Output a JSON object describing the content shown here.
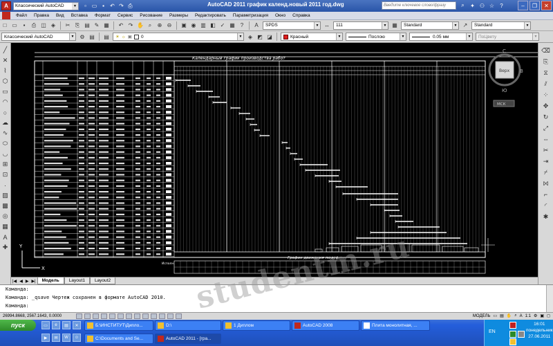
{
  "titlebar": {
    "workspace": "Классический AutoCAD",
    "title": "AutoCAD 2011     график календ.новый 2011 год.dwg",
    "search_placeholder": "Введите ключевое слово/фразу"
  },
  "menu": {
    "items": [
      "Файл",
      "Правка",
      "Вид",
      "Вставка",
      "Формат",
      "Сервис",
      "Рисование",
      "Размеры",
      "Редактировать",
      "Параметризация",
      "Окно",
      "Справка"
    ]
  },
  "toolbar1": {
    "text_style": "SPDS",
    "text_height": "111",
    "dim_style": "Standard",
    "table_style": "Standard"
  },
  "toolbar2": {
    "workspace": "Классический AutoCAD",
    "layer": "0",
    "color": "Красный",
    "color_hex": "#e02020",
    "linetype": "Послою",
    "lineweight": "0.05 мм",
    "plotstyle": "ПоЦвету"
  },
  "drawing": {
    "title": "Календарный график производства работ",
    "graph_label": "График движения людей",
    "viewcube": {
      "top": "Верх",
      "north": "С",
      "east": "В",
      "south": "Ю",
      "wcs": "МСК"
    },
    "ucs": {
      "y": "Y",
      "x": "X"
    },
    "bottom_label": "Исполн."
  },
  "layout_tabs": [
    "Модель",
    "Layout1",
    "Layout2"
  ],
  "command": {
    "lines": [
      "Команда:",
      "Команда:  _qsave Чертеж сохранен в формате AutoCAD 2010.",
      "Команда:"
    ]
  },
  "status": {
    "coords": "26994.8668, 2567.1643, 0.0000",
    "model": "МОДЕЛЬ",
    "scale": "1:1"
  },
  "taskbar": {
    "start": "пуск",
    "tasks_row1": [
      "Б:\\ИНСТИТУТ\\Дипло...",
      "D:\\",
      "1 Диплом",
      "AutoCAD 2008",
      "Плита монолитная, ..."
    ],
    "tasks_row2": [
      "C:\\Documents and Se...",
      "AutoCAD 2011 - [гра..."
    ],
    "lang": "EN",
    "time": "16:01",
    "day": "понедельник",
    "date": "27.06.2011"
  },
  "watermark": "studentm.ru"
}
